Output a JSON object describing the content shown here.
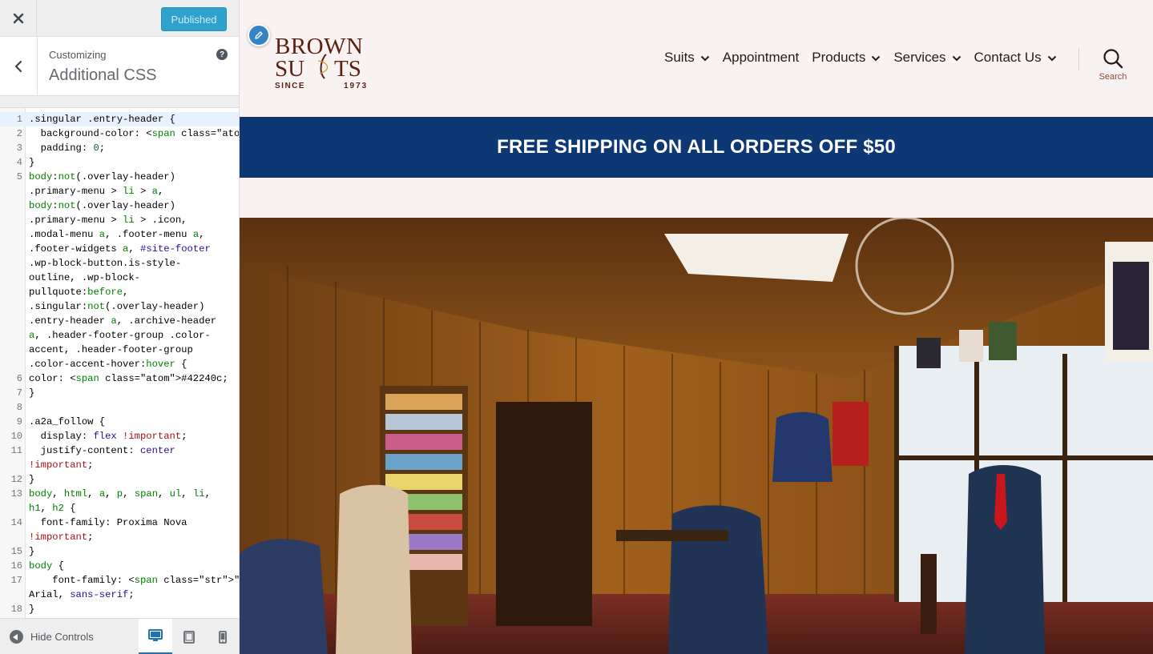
{
  "customizer": {
    "close_icon": "close-icon",
    "publish_label": "Published",
    "back_icon": "chevron-left-icon",
    "customizing_label": "Customizing",
    "section_title": "Additional CSS",
    "help_icon": "help-icon",
    "help_glyph": "?",
    "footer": {
      "hide_controls_label": "Hide Controls",
      "devices": [
        "desktop",
        "tablet",
        "mobile"
      ]
    }
  },
  "css_editor": {
    "lines": [
      {
        "n": "1",
        "t": ".singular .entry-header {"
      },
      {
        "n": "2",
        "t": "  background-color: #fff;"
      },
      {
        "n": "3",
        "t": "  padding: 0;"
      },
      {
        "n": "4",
        "t": "}"
      },
      {
        "n": "5",
        "t": "body:not(.overlay-header)"
      },
      {
        "n": "",
        "t": ".primary-menu > li > a,"
      },
      {
        "n": "",
        "t": "body:not(.overlay-header)"
      },
      {
        "n": "",
        "t": ".primary-menu > li > .icon,"
      },
      {
        "n": "",
        "t": ".modal-menu a, .footer-menu a,"
      },
      {
        "n": "",
        "t": ".footer-widgets a, #site-footer"
      },
      {
        "n": "",
        "t": ".wp-block-button.is-style-"
      },
      {
        "n": "",
        "t": "outline, .wp-block-"
      },
      {
        "n": "",
        "t": "pullquote:before,"
      },
      {
        "n": "",
        "t": ".singular:not(.overlay-header)"
      },
      {
        "n": "",
        "t": ".entry-header a, .archive-header"
      },
      {
        "n": "",
        "t": "a, .header-footer-group .color-"
      },
      {
        "n": "",
        "t": "accent, .header-footer-group"
      },
      {
        "n": "",
        "t": ".color-accent-hover:hover {"
      },
      {
        "n": "6",
        "t": "color: #42240c;"
      },
      {
        "n": "7",
        "t": "}"
      },
      {
        "n": "8",
        "t": ""
      },
      {
        "n": "9",
        "t": ".a2a_follow {"
      },
      {
        "n": "10",
        "t": "  display: flex !important;"
      },
      {
        "n": "11",
        "t": "  justify-content: center"
      },
      {
        "n": "",
        "t": "!important;"
      },
      {
        "n": "12",
        "t": "}"
      },
      {
        "n": "13",
        "t": "body, html, a, p, span, ul, li,"
      },
      {
        "n": "",
        "t": "h1, h2 {"
      },
      {
        "n": "14",
        "t": "  font-family: Proxima Nova"
      },
      {
        "n": "",
        "t": "!important;"
      },
      {
        "n": "15",
        "t": "}"
      },
      {
        "n": "16",
        "t": "body {"
      },
      {
        "n": "17",
        "t": "    font-family: \"Proxima Nova\","
      },
      {
        "n": "",
        "t": "Arial, sans-serif;"
      },
      {
        "n": "18",
        "t": "}"
      }
    ]
  },
  "site": {
    "logo": {
      "line1": "BROWN",
      "line2_a": "SU",
      "line2_b": "TS",
      "since": "SINCE",
      "year": "1973"
    },
    "nav": [
      {
        "label": "Suits",
        "has_submenu": true
      },
      {
        "label": "Appointment",
        "has_submenu": false
      },
      {
        "label": "Products",
        "has_submenu": true
      },
      {
        "label": "Services",
        "has_submenu": true
      },
      {
        "label": "Contact Us",
        "has_submenu": true
      }
    ],
    "search_label": "Search",
    "banner_text": "FREE SHIPPING ON ALL ORDERS OFF $50",
    "colors": {
      "banner": "#0d3874",
      "header_bg": "#f9f2f2",
      "publish": "#2ea2cc",
      "logo": "#5a1f12"
    }
  }
}
